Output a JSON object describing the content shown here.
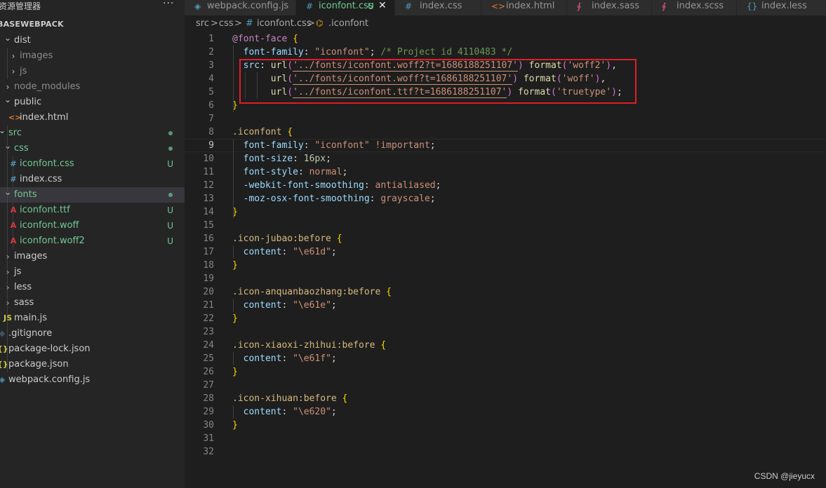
{
  "explorer": {
    "title": "资源管理器",
    "more": "···",
    "project_root": "BASEWEBPACK",
    "items": [
      {
        "label": "dist",
        "type": "folder",
        "open": true,
        "status": "",
        "color": "#cccccc"
      },
      {
        "label": "images",
        "type": "folder",
        "open": false,
        "status": "",
        "color": "#8c8c8c"
      },
      {
        "label": "js",
        "type": "folder",
        "open": false,
        "status": "",
        "color": "#8c8c8c"
      },
      {
        "label": "node_modules",
        "type": "folder",
        "open": false,
        "status": "",
        "color": "#8c8c8c"
      },
      {
        "label": "public",
        "type": "folder",
        "open": true,
        "status": "",
        "color": "#cccccc"
      },
      {
        "label": "index.html",
        "type": "html",
        "status": "",
        "color": "#cccccc"
      },
      {
        "label": "src",
        "type": "folder",
        "open": true,
        "status": "dot",
        "color": "#73c991"
      },
      {
        "label": "css",
        "type": "folder",
        "open": true,
        "status": "dot",
        "color": "#73c991"
      },
      {
        "label": "iconfont.css",
        "type": "css",
        "status": "U",
        "color": "#73c991"
      },
      {
        "label": "index.css",
        "type": "css",
        "status": "",
        "color": "#cccccc"
      },
      {
        "label": "fonts",
        "type": "folder",
        "open": true,
        "status": "dot",
        "color": "#73c991"
      },
      {
        "label": "iconfont.ttf",
        "type": "font",
        "status": "U",
        "color": "#73c991"
      },
      {
        "label": "iconfont.woff",
        "type": "font",
        "status": "U",
        "color": "#73c991"
      },
      {
        "label": "iconfont.woff2",
        "type": "font",
        "status": "U",
        "color": "#73c991"
      },
      {
        "label": "images",
        "type": "folder",
        "open": false,
        "status": "",
        "color": "#cccccc"
      },
      {
        "label": "js",
        "type": "folder",
        "open": false,
        "status": "",
        "color": "#cccccc"
      },
      {
        "label": "less",
        "type": "folder",
        "open": false,
        "status": "",
        "color": "#cccccc"
      },
      {
        "label": "sass",
        "type": "folder",
        "open": false,
        "status": "",
        "color": "#cccccc"
      },
      {
        "label": "main.js",
        "type": "js",
        "status": "",
        "color": "#cccccc"
      },
      {
        "label": ".gitignore",
        "type": "git",
        "status": "",
        "color": "#cccccc"
      },
      {
        "label": "package-lock.json",
        "type": "json",
        "status": "",
        "color": "#cccccc"
      },
      {
        "label": "package.json",
        "type": "json",
        "status": "",
        "color": "#cccccc"
      },
      {
        "label": "webpack.config.js",
        "type": "webpack",
        "status": "",
        "color": "#cccccc"
      }
    ]
  },
  "tabs": [
    {
      "label": "webpack.config.js",
      "icon": "webpack",
      "active": false
    },
    {
      "label": "iconfont.css",
      "icon": "css",
      "active": true,
      "modified": "U",
      "close": "✕"
    },
    {
      "label": "index.css",
      "icon": "css",
      "active": false
    },
    {
      "label": "index.html",
      "icon": "html",
      "active": false
    },
    {
      "label": "index.sass",
      "icon": "sass",
      "active": false
    },
    {
      "label": "index.scss",
      "icon": "sass",
      "active": false
    },
    {
      "label": "index.less",
      "icon": "less",
      "active": false
    }
  ],
  "breadcrumb": {
    "seg1": "src",
    "sep1": ">",
    "seg2": "css",
    "sep2": ">",
    "file_icon": "#",
    "seg3": "iconfont.css",
    "sep3": ">",
    "sym_icon": "⌬",
    "seg4": ".iconfont"
  },
  "editor": {
    "current_line": 9,
    "lines": [
      [
        [
          "c-at",
          "@font-face"
        ],
        [
          "c-plain",
          " "
        ],
        [
          "c-brace",
          "{"
        ]
      ],
      [
        [
          "c-plain",
          "  "
        ],
        [
          "c-prop",
          "font-family"
        ],
        [
          "c-plain",
          ": "
        ],
        [
          "c-str",
          "\"iconfont\""
        ],
        [
          "c-plain",
          "; "
        ],
        [
          "c-comment",
          "/* Project id 4110483 */"
        ]
      ],
      [
        [
          "c-plain",
          "  "
        ],
        [
          "c-prop",
          "src"
        ],
        [
          "c-plain",
          ": "
        ],
        [
          "c-fn",
          "url"
        ],
        [
          "c-paren",
          "("
        ],
        [
          "c-url",
          "'../fonts/iconfont.woff2?t=1686188251107'"
        ],
        [
          "c-paren",
          ")"
        ],
        [
          "c-plain",
          " "
        ],
        [
          "c-fn",
          "format"
        ],
        [
          "c-paren",
          "("
        ],
        [
          "c-str",
          "'woff2'"
        ],
        [
          "c-paren",
          ")"
        ],
        [
          "c-plain",
          ","
        ]
      ],
      [
        [
          "c-plain",
          "       "
        ],
        [
          "c-fn",
          "url"
        ],
        [
          "c-paren",
          "("
        ],
        [
          "c-url",
          "'../fonts/iconfont.woff?t=1686188251107'"
        ],
        [
          "c-paren",
          ")"
        ],
        [
          "c-plain",
          " "
        ],
        [
          "c-fn",
          "format"
        ],
        [
          "c-paren",
          "("
        ],
        [
          "c-str",
          "'woff'"
        ],
        [
          "c-paren",
          ")"
        ],
        [
          "c-plain",
          ","
        ]
      ],
      [
        [
          "c-plain",
          "       "
        ],
        [
          "c-fn",
          "url"
        ],
        [
          "c-paren",
          "("
        ],
        [
          "c-url",
          "'../fonts/iconfont.ttf?t=1686188251107'"
        ],
        [
          "c-paren",
          ")"
        ],
        [
          "c-plain",
          " "
        ],
        [
          "c-fn",
          "format"
        ],
        [
          "c-paren",
          "("
        ],
        [
          "c-str",
          "'truetype'"
        ],
        [
          "c-paren",
          ")"
        ],
        [
          "c-plain",
          ";"
        ]
      ],
      [
        [
          "c-brace",
          "}"
        ]
      ],
      [],
      [
        [
          "c-sel",
          ".iconfont"
        ],
        [
          "c-plain",
          " "
        ],
        [
          "c-brace",
          "{"
        ]
      ],
      [
        [
          "c-plain",
          "  "
        ],
        [
          "c-prop",
          "font-family"
        ],
        [
          "c-plain",
          ": "
        ],
        [
          "c-str",
          "\"iconfont\""
        ],
        [
          "c-plain",
          " "
        ],
        [
          "c-str",
          "!important"
        ],
        [
          "c-plain",
          ";"
        ]
      ],
      [
        [
          "c-plain",
          "  "
        ],
        [
          "c-prop",
          "font-size"
        ],
        [
          "c-plain",
          ": "
        ],
        [
          "c-num",
          "16px"
        ],
        [
          "c-plain",
          ";"
        ]
      ],
      [
        [
          "c-plain",
          "  "
        ],
        [
          "c-prop",
          "font-style"
        ],
        [
          "c-plain",
          ": "
        ],
        [
          "c-str",
          "normal"
        ],
        [
          "c-plain",
          ";"
        ]
      ],
      [
        [
          "c-plain",
          "  "
        ],
        [
          "c-prop",
          "-webkit-font-smoothing"
        ],
        [
          "c-plain",
          ": "
        ],
        [
          "c-str",
          "antialiased"
        ],
        [
          "c-plain",
          ";"
        ]
      ],
      [
        [
          "c-plain",
          "  "
        ],
        [
          "c-prop",
          "-moz-osx-font-smoothing"
        ],
        [
          "c-plain",
          ": "
        ],
        [
          "c-str",
          "grayscale"
        ],
        [
          "c-plain",
          ";"
        ]
      ],
      [
        [
          "c-brace",
          "}"
        ]
      ],
      [],
      [
        [
          "c-sel",
          ".icon-jubao:before"
        ],
        [
          "c-plain",
          " "
        ],
        [
          "c-brace",
          "{"
        ]
      ],
      [
        [
          "c-plain",
          "  "
        ],
        [
          "c-prop",
          "content"
        ],
        [
          "c-plain",
          ": "
        ],
        [
          "c-str",
          "\"\\e61d\""
        ],
        [
          "c-plain",
          ";"
        ]
      ],
      [
        [
          "c-brace",
          "}"
        ]
      ],
      [],
      [
        [
          "c-sel",
          ".icon-anquanbaozhang:before"
        ],
        [
          "c-plain",
          " "
        ],
        [
          "c-brace",
          "{"
        ]
      ],
      [
        [
          "c-plain",
          "  "
        ],
        [
          "c-prop",
          "content"
        ],
        [
          "c-plain",
          ": "
        ],
        [
          "c-str",
          "\"\\e61e\""
        ],
        [
          "c-plain",
          ";"
        ]
      ],
      [
        [
          "c-brace",
          "}"
        ]
      ],
      [],
      [
        [
          "c-sel",
          ".icon-xiaoxi-zhihui:before"
        ],
        [
          "c-plain",
          " "
        ],
        [
          "c-brace",
          "{"
        ]
      ],
      [
        [
          "c-plain",
          "  "
        ],
        [
          "c-prop",
          "content"
        ],
        [
          "c-plain",
          ": "
        ],
        [
          "c-str",
          "\"\\e61f\""
        ],
        [
          "c-plain",
          ";"
        ]
      ],
      [
        [
          "c-brace",
          "}"
        ]
      ],
      [],
      [
        [
          "c-sel",
          ".icon-xihuan:before"
        ],
        [
          "c-plain",
          " "
        ],
        [
          "c-brace",
          "{"
        ]
      ],
      [
        [
          "c-plain",
          "  "
        ],
        [
          "c-prop",
          "content"
        ],
        [
          "c-plain",
          ": "
        ],
        [
          "c-str",
          "\"\\e620\""
        ],
        [
          "c-plain",
          ";"
        ]
      ],
      [
        [
          "c-brace",
          "}"
        ]
      ],
      [],
      []
    ]
  },
  "watermark": "CSDN @jieyucx",
  "colors": {
    "accent_highlight": "#e11d2a",
    "git_untracked": "#73c991",
    "editor_bg": "#1e1e1e",
    "sidebar_bg": "#252526"
  }
}
